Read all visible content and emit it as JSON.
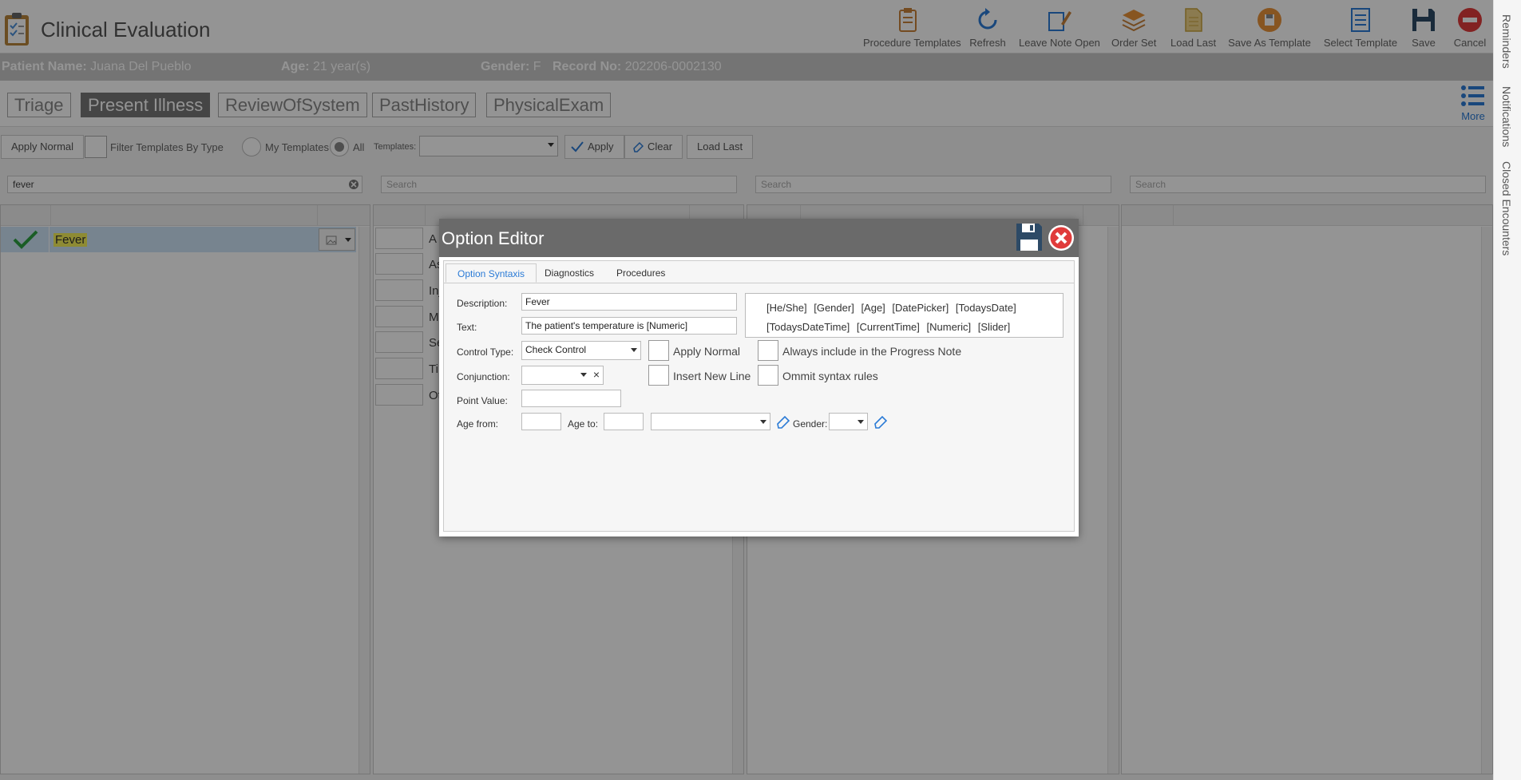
{
  "app": {
    "title": "Clinical Evaluation"
  },
  "toolbar": [
    {
      "label": "Procedure Templates",
      "icon": "clipboard-icon"
    },
    {
      "label": "Refresh",
      "icon": "refresh-icon"
    },
    {
      "label": "Leave Note Open",
      "icon": "pen-note-icon"
    },
    {
      "label": "Order Set",
      "icon": "layers-icon"
    },
    {
      "label": "Load Last",
      "icon": "document-icon"
    },
    {
      "label": "Save As Template",
      "icon": "save-as-icon"
    },
    {
      "label": "Select Template",
      "icon": "list-document-icon"
    },
    {
      "label": "Save",
      "icon": "floppy-disk-icon"
    },
    {
      "label": "Cancel",
      "icon": "cancel-icon"
    }
  ],
  "patient": {
    "name_label": "Patient Name:",
    "name": "Juana Del Pueblo",
    "age_label": "Age:",
    "age": "21 year(s)",
    "gender_label": "Gender:",
    "gender": "F",
    "record_label": "Record No:",
    "record": "202206-0002130"
  },
  "tabs": [
    "Triage",
    "Present Illness",
    "ReviewOfSystem",
    "PastHistory",
    "PhysicalExam"
  ],
  "active_tab": "Present Illness",
  "more_label": "More",
  "filter": {
    "apply_normal": "Apply Normal",
    "filter_by_type": "Filter Templates By Type",
    "my_templates": "My Templates",
    "all": "All",
    "templates_label": "Templates:",
    "templates_value": "",
    "apply": "Apply",
    "clear": "Clear",
    "load_last": "Load Last"
  },
  "search": {
    "query": "fever",
    "placeholder": "Search"
  },
  "left_list": {
    "item": "Fever"
  },
  "mid_list": [
    "A",
    "As",
    "Inj",
    "M",
    "Se",
    "Ti",
    "Ot"
  ],
  "side_tabs": [
    "Reminders",
    "Notifications",
    "Closed Encounters"
  ],
  "modal": {
    "title": "Option Editor",
    "tabs": [
      "Option Syntaxis",
      "Diagnostics",
      "Procedures"
    ],
    "active_tab": "Option Syntaxis",
    "description_label": "Description:",
    "description": "Fever",
    "text_label": "Text:",
    "text": "The patient's temperature is [Numeric]",
    "control_type_label": "Control Type:",
    "control_type": "Check Control",
    "conjunction_label": "Conjunction:",
    "conjunction": "",
    "point_value_label": "Point Value:",
    "point_value": "",
    "age_from_label": "Age from:",
    "age_from": "",
    "age_to_label": "Age to:",
    "age_to": "",
    "age_unit": "",
    "gender_label": "Gender:",
    "gender": "",
    "apply_normal": "Apply Normal",
    "always_include": "Always include in the Progress Note",
    "insert_new_line": "Insert New Line",
    "ommit_syntax": "Ommit syntax rules",
    "tokens": [
      "[He/She]",
      "[Gender]",
      "[Age]",
      "[DatePicker]",
      "[TodaysDate]",
      "[TodaysDateTime]",
      "[CurrentTime]",
      "[Numeric]",
      "[Slider]"
    ]
  }
}
